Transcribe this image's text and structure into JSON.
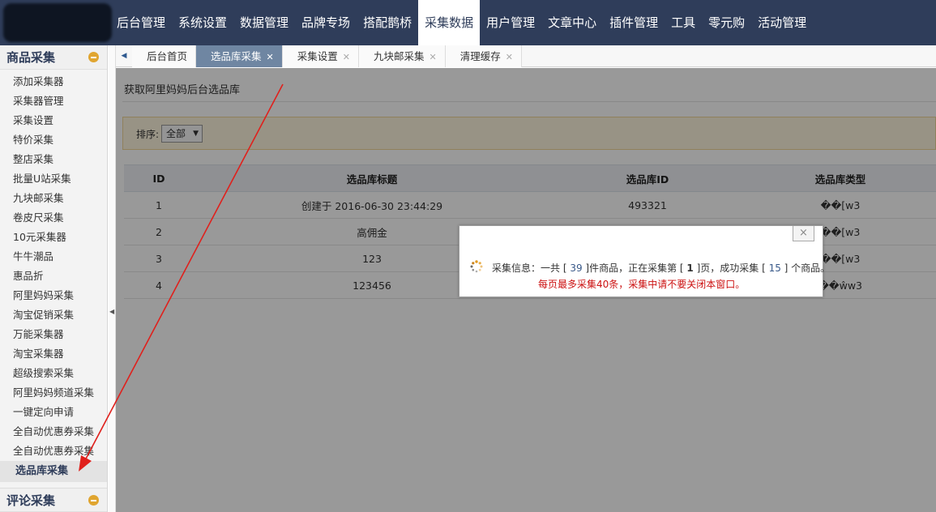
{
  "topnav": {
    "items": [
      "后台管理",
      "系统设置",
      "数据管理",
      "品牌专场",
      "搭配鹊桥",
      "采集数据",
      "用户管理",
      "文章中心",
      "插件管理",
      "工具",
      "零元购",
      "活动管理"
    ],
    "active": "采集数据"
  },
  "sidebar": {
    "section_title": "商品采集",
    "items": [
      "添加采集器",
      "采集器管理",
      "采集设置",
      "特价采集",
      "整店采集",
      "批量U站采集",
      "九块邮采集",
      "卷皮尺采集",
      "10元采集器",
      "牛牛潮品",
      "惠品折",
      "阿里妈妈采集",
      "淘宝促销采集",
      "万能采集器",
      "淘宝采集器",
      "超级搜索采集",
      "阿里妈妈频道采集",
      "一键定向申请",
      "全自动优惠券采集",
      "全自动优惠券采集"
    ],
    "active_item": "选品库采集",
    "bottom_section_title": "评论采集"
  },
  "tabs": [
    {
      "label": "后台首页",
      "closable": false,
      "active": false
    },
    {
      "label": "选品库采集",
      "closable": true,
      "active": true
    },
    {
      "label": "采集设置",
      "closable": true,
      "active": false
    },
    {
      "label": "九块邮采集",
      "closable": true,
      "active": false
    },
    {
      "label": "清理缓存",
      "closable": true,
      "active": false
    }
  ],
  "main": {
    "heading": "获取阿里妈妈后台选品库",
    "filter_label": "排序:",
    "filter_value": "全部",
    "table": {
      "headers": [
        "ID",
        "选品库标题",
        "选品库ID",
        "选品库类型"
      ],
      "rows": [
        [
          "1",
          "创建于 2016-06-30 23:44:29",
          "493321",
          "��[w3"
        ],
        [
          "2",
          "高佣金",
          "",
          "��[w3"
        ],
        [
          "3",
          "123",
          "",
          "��[w3"
        ],
        [
          "4",
          "123456",
          "",
          "��ŵw3"
        ]
      ]
    }
  },
  "dialog": {
    "line1_a": "采集信息：一共 [ ",
    "total": "39",
    "line1_b": " ]件商品，正在采集第 [ ",
    "page": "1",
    "line1_c": " ]页，成功采集 [ ",
    "success": "15",
    "line1_d": " ] 个商品。",
    "line2": "每页最多采集40条，采集中请不要关闭本窗口。",
    "close_icon": "×"
  },
  "colors": {
    "topbar": "#2f3d5a",
    "active_tab": "#6f86a2",
    "annotation_arrow": "#e0201c",
    "warning_text": "#cc1111"
  }
}
